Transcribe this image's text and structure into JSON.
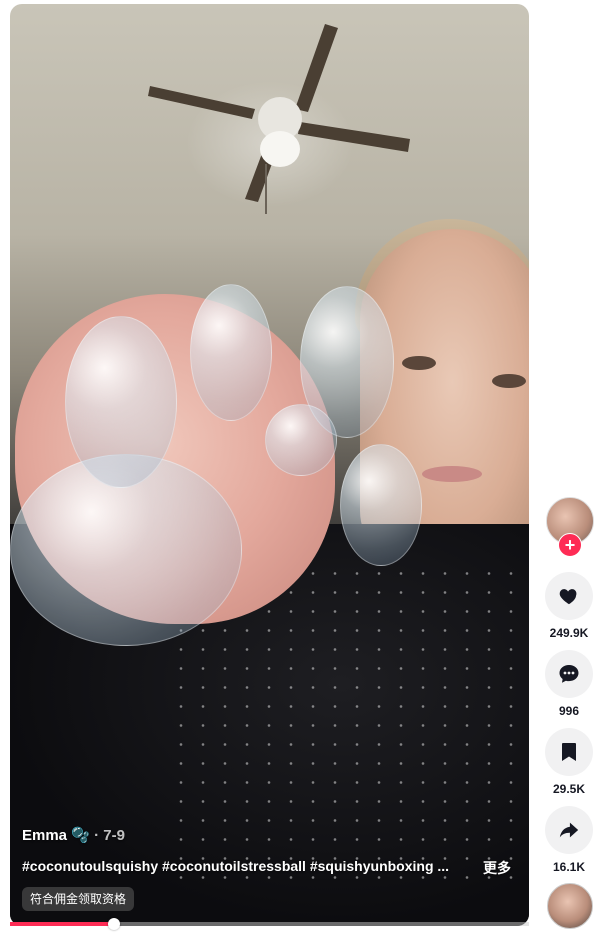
{
  "video": {
    "author": "Emma",
    "author_suffix": "🫧",
    "date": "· 7-9",
    "description": "#coconutoulsquishy #coconutoilstressball #squishyunboxing ...",
    "more_label": "更多",
    "commission_badge": "符合佣金领取资格",
    "progress_fraction": 0.2
  },
  "actions": {
    "likes": "249.9K",
    "comments": "996",
    "saves": "29.5K",
    "shares": "16.1K",
    "follow_symbol": "+"
  },
  "colors": {
    "accent": "#fe2c55",
    "action_bg": "#f1f1f2",
    "count_text": "#161823"
  },
  "icons": [
    "heart-icon",
    "comment-icon",
    "bookmark-icon",
    "share-icon",
    "plus-icon"
  ]
}
